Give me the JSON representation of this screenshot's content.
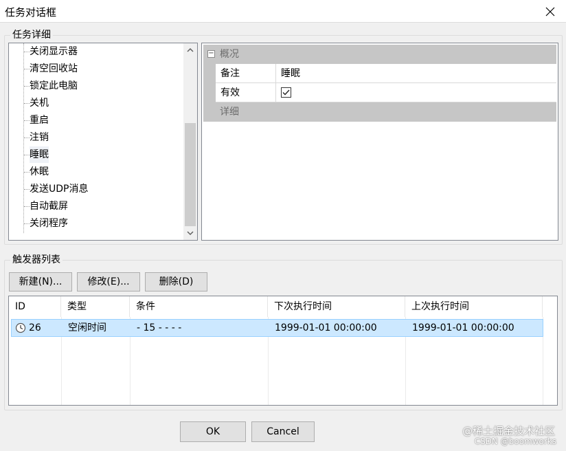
{
  "window": {
    "title": "任务对话框"
  },
  "task_details": {
    "group_label": "任务详细",
    "tree_items": [
      "关闭显示器",
      "清空回收站",
      "锁定此电脑",
      "关机",
      "重启",
      "注销",
      "睡眠",
      "休眠",
      "发送UDP消息",
      "自动截屏",
      "关闭程序"
    ],
    "selected_item": "睡眠",
    "property_grid": {
      "category_overview": "概况",
      "rows": [
        {
          "name": "备注",
          "value": "睡眠"
        },
        {
          "name": "有效",
          "value": "",
          "checked": true
        }
      ],
      "category_detail": "详细"
    }
  },
  "triggers": {
    "group_label": "触发器列表",
    "buttons": {
      "new": "新建(N)...",
      "edit": "修改(E)...",
      "delete": "删除(D)"
    },
    "columns": [
      "ID",
      "类型",
      "条件",
      "下次执行时间",
      "上次执行时间"
    ],
    "rows": [
      {
        "id": "26",
        "type": "空闲时间",
        "condition": "- 15 - - - -",
        "next": "1999-01-01 00:00:00",
        "last": "1999-01-01 00:00:00",
        "icon": "clock-icon"
      }
    ]
  },
  "footer": {
    "ok": "OK",
    "cancel": "Cancel"
  },
  "watermark": {
    "line1": "@稀土掘金技术社区",
    "line2": "CSDN @boomworks"
  },
  "colors": {
    "selection": "#cce8ff",
    "selection_border": "#99d1ff",
    "category": "#c6c6c6"
  }
}
